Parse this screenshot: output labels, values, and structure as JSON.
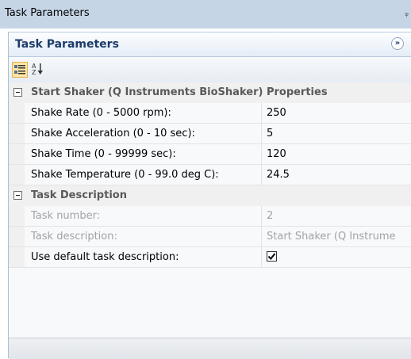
{
  "window": {
    "title": "Task Parameters"
  },
  "panel": {
    "title": "Task Parameters",
    "collapse_glyph": "»"
  },
  "toolbar": {
    "buttons": [
      {
        "name": "categorized-view",
        "icon": "categorized-icon",
        "active": true
      },
      {
        "name": "alphabetical-sort",
        "icon": "sort-az-icon",
        "active": false
      }
    ]
  },
  "grid": {
    "categories": [
      {
        "label": "Start Shaker (Q Instruments BioShaker) Properties",
        "properties": [
          {
            "name": "Shake Rate (0 - 5000 rpm):",
            "value": "250"
          },
          {
            "name": "Shake Acceleration (0 - 10 sec):",
            "value": "5"
          },
          {
            "name": "Shake Time (0 - 99999 sec):",
            "value": "120"
          },
          {
            "name": "Shake Temperature (0 - 99.0 deg C):",
            "value": "24.5"
          }
        ]
      },
      {
        "label": "Task Description",
        "properties": [
          {
            "name": "Task number:",
            "value": "2",
            "disabled": true
          },
          {
            "name": "Task description:",
            "value": "Start Shaker (Q Instrume",
            "disabled": true
          },
          {
            "name": "Use default task description:",
            "checked": true
          }
        ]
      }
    ]
  },
  "colors": {
    "title_bar": "#c6d5e6",
    "group_title": "#1c3c6a",
    "category_bg": "#f0f0f0",
    "disabled_text": "#a3a3a3"
  }
}
